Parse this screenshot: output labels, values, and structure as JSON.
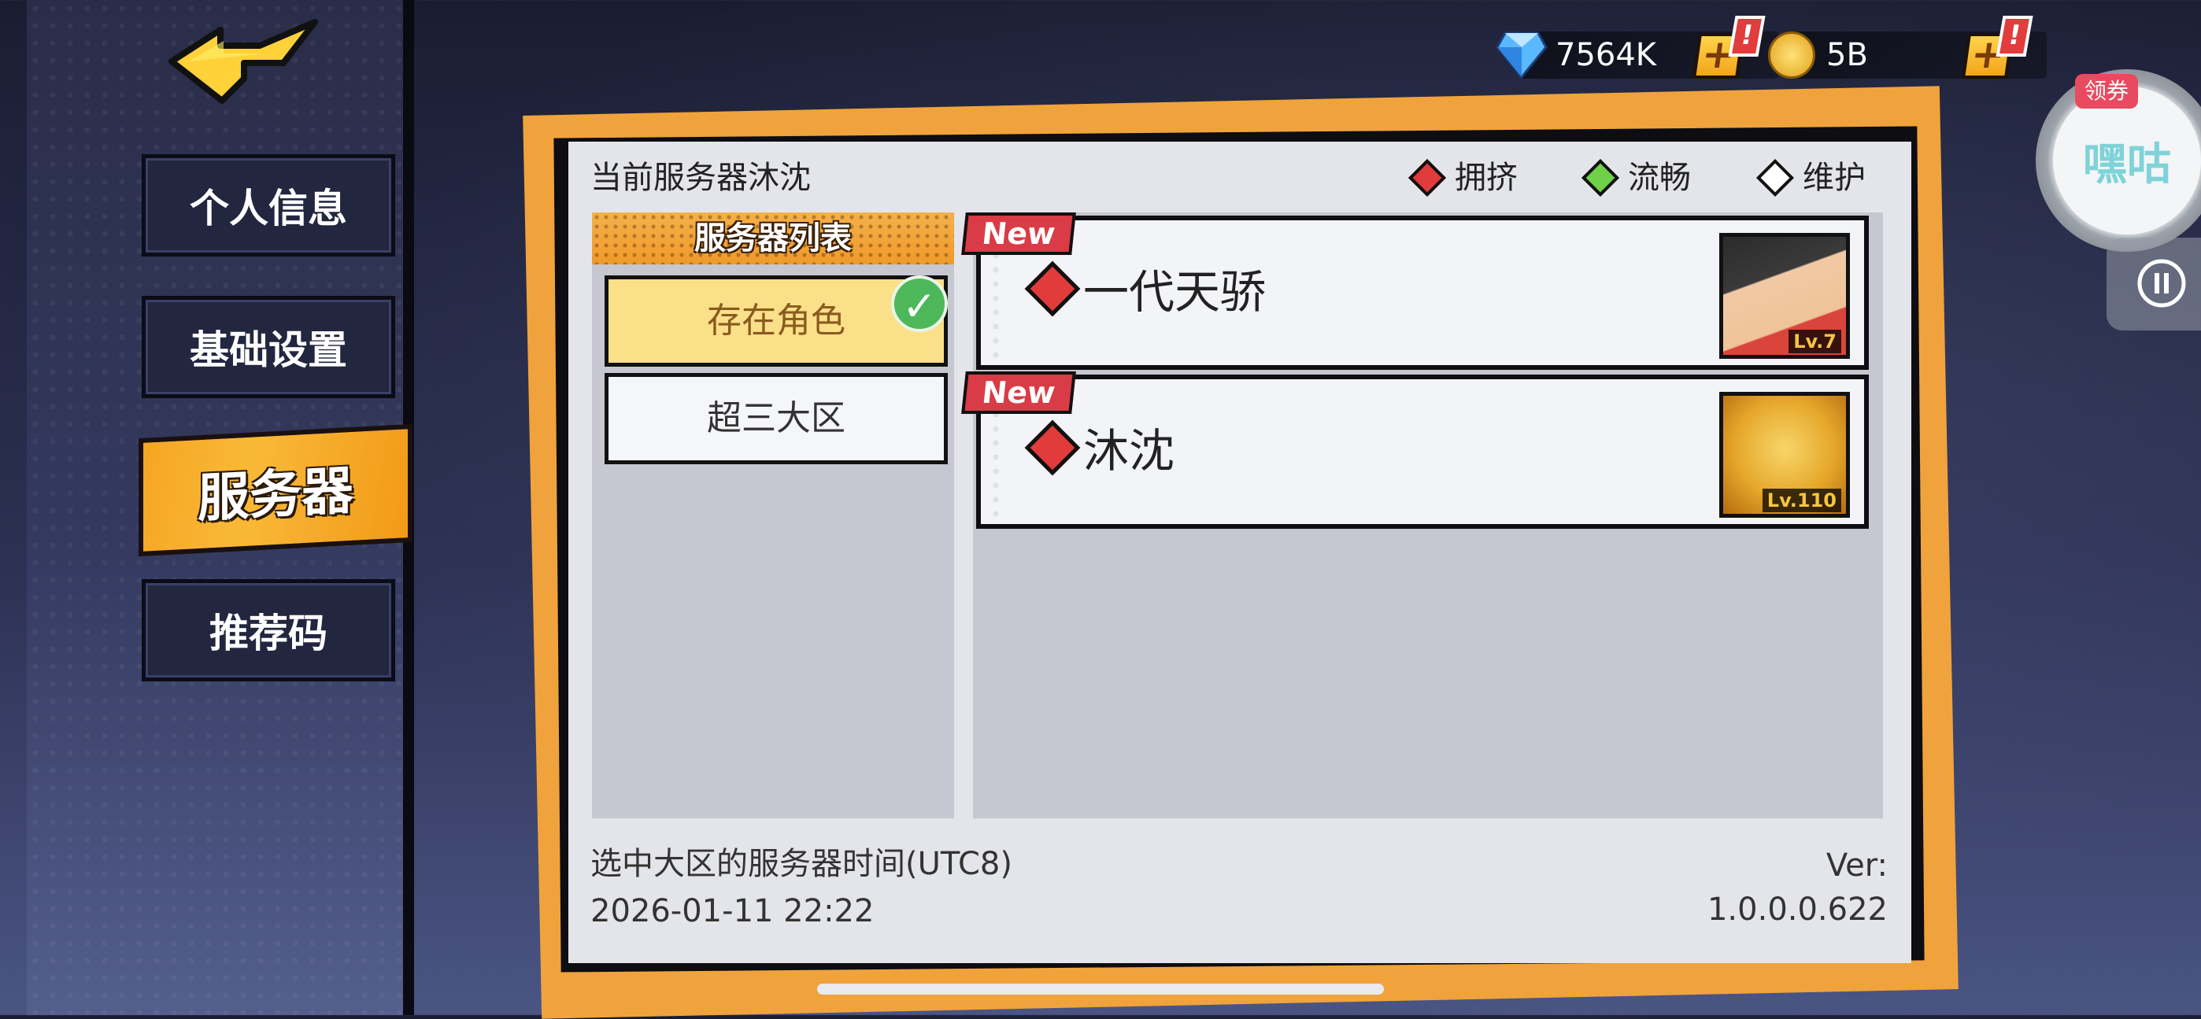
{
  "sidebar": {
    "items": [
      {
        "label": "个人信息"
      },
      {
        "label": "基础设置"
      },
      {
        "label": "服务器"
      },
      {
        "label": "推荐码"
      }
    ]
  },
  "currency": {
    "gems": "7564K",
    "gold": "5B",
    "plus": "+",
    "alert": "!"
  },
  "coupon": {
    "tag": "领券",
    "text": "嘿咕"
  },
  "panel": {
    "current_server": "当前服务器沐沈",
    "legend": [
      {
        "label": "拥挤",
        "color": "#e23b3b"
      },
      {
        "label": "流畅",
        "color": "#6fd04a"
      },
      {
        "label": "维护",
        "color": "#ffffff"
      }
    ],
    "list_title": "服务器列表",
    "categories": [
      {
        "label": "存在角色",
        "selected": true
      },
      {
        "label": "超三大区",
        "selected": false
      }
    ],
    "servers": [
      {
        "tag": "New",
        "name": "一代天骄",
        "level": "Lv.7",
        "status_color": "#e23b3b"
      },
      {
        "tag": "New",
        "name": "沐沈",
        "level": "Lv.110",
        "status_color": "#e23b3b"
      }
    ],
    "time_label": "选中大区的服务器时间(UTC8)",
    "time_value": "2026-01-11 22:22",
    "version": "Ver: 1.0.0.0.622"
  }
}
